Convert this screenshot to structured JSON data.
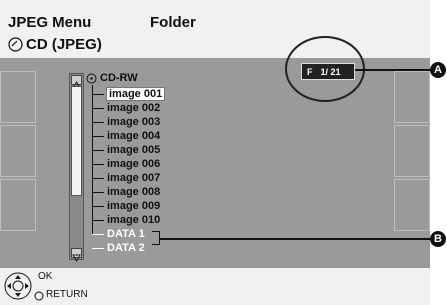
{
  "header": {
    "title": "JPEG Menu",
    "folder_label": "Folder",
    "disc_label": "CD (JPEG)"
  },
  "tree": {
    "root": "CD-RW",
    "items": [
      "image 001",
      "image 002",
      "image 003",
      "image 004",
      "image 005",
      "image 006",
      "image 007",
      "image 008",
      "image 009",
      "image 010"
    ],
    "selected_index": 0,
    "data_folders": [
      "DATA 1",
      "DATA 2"
    ]
  },
  "page_indicator": {
    "prefix": "F",
    "value": "1/ 21"
  },
  "callouts": {
    "a": "A",
    "b": "B"
  },
  "footer": {
    "ok_label": "OK",
    "return_label": "RETURN"
  },
  "colors": {
    "background": "#9a9a9a",
    "header": "#f1f1f1",
    "data_text": "#ffffff"
  }
}
